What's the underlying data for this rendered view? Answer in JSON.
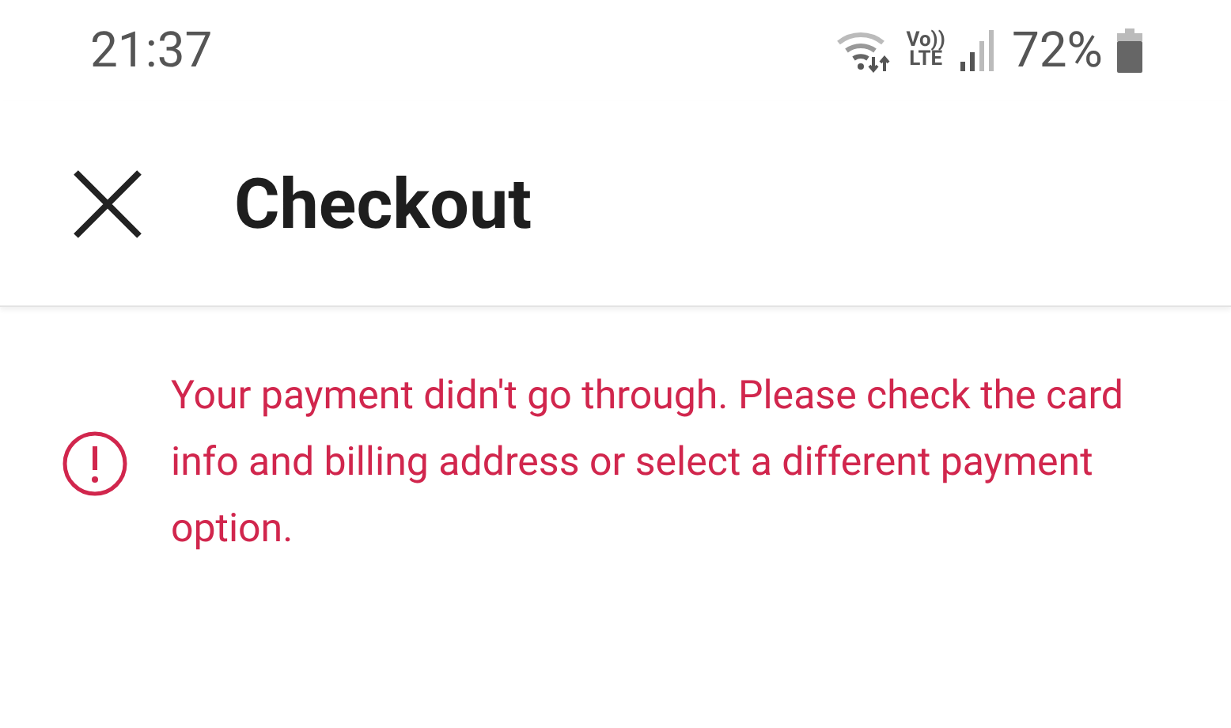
{
  "status_bar": {
    "time": "21:37",
    "network": [
      "Vo))",
      "LTE"
    ],
    "battery": "72%"
  },
  "header": {
    "title": "Checkout"
  },
  "error": {
    "message": "Your payment didn't go through. Please check the card info and billing address or select a different payment option."
  }
}
